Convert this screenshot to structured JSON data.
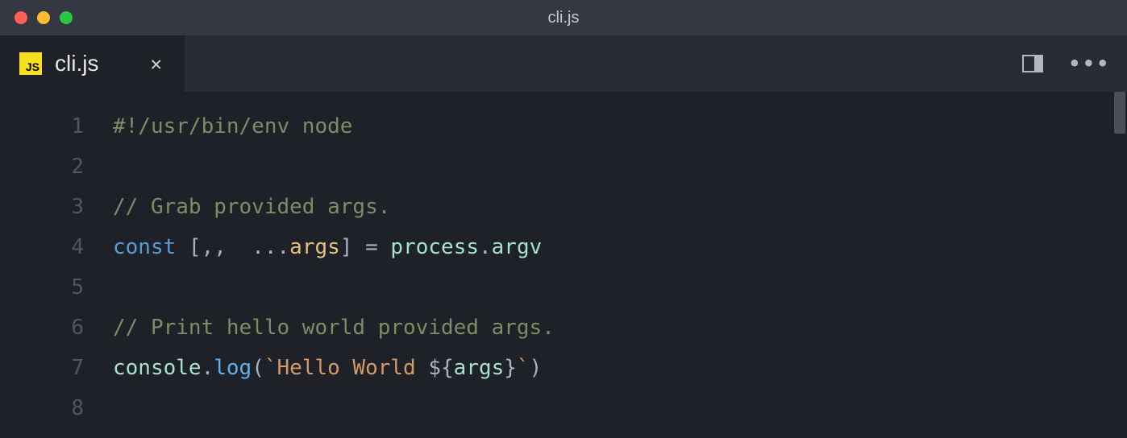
{
  "window": {
    "title": "cli.js"
  },
  "tab": {
    "icon_text": "JS",
    "label": "cli.js",
    "close_glyph": "✕"
  },
  "toolbar": {
    "more_glyph": "•••"
  },
  "gutter": {
    "lines": [
      "1",
      "2",
      "3",
      "4",
      "5",
      "6",
      "7",
      "8"
    ]
  },
  "code": {
    "l1": {
      "shebang": "#!/usr/bin/env node"
    },
    "l3": {
      "comment": "// Grab provided args."
    },
    "l4": {
      "const": "const",
      "open": " [,,  ...",
      "args": "args",
      "close": "] ",
      "eq": "=",
      "sp": " ",
      "process": "process",
      "dot": ".",
      "argv": "argv"
    },
    "l6": {
      "comment": "// Print hello world provided args."
    },
    "l7": {
      "console": "console",
      "dot1": ".",
      "log": "log",
      "open": "(",
      "tick1": "`",
      "str": "Hello World ",
      "iopen": "${",
      "args": "args",
      "iclose": "}",
      "tick2": "`",
      "close": ")"
    }
  }
}
